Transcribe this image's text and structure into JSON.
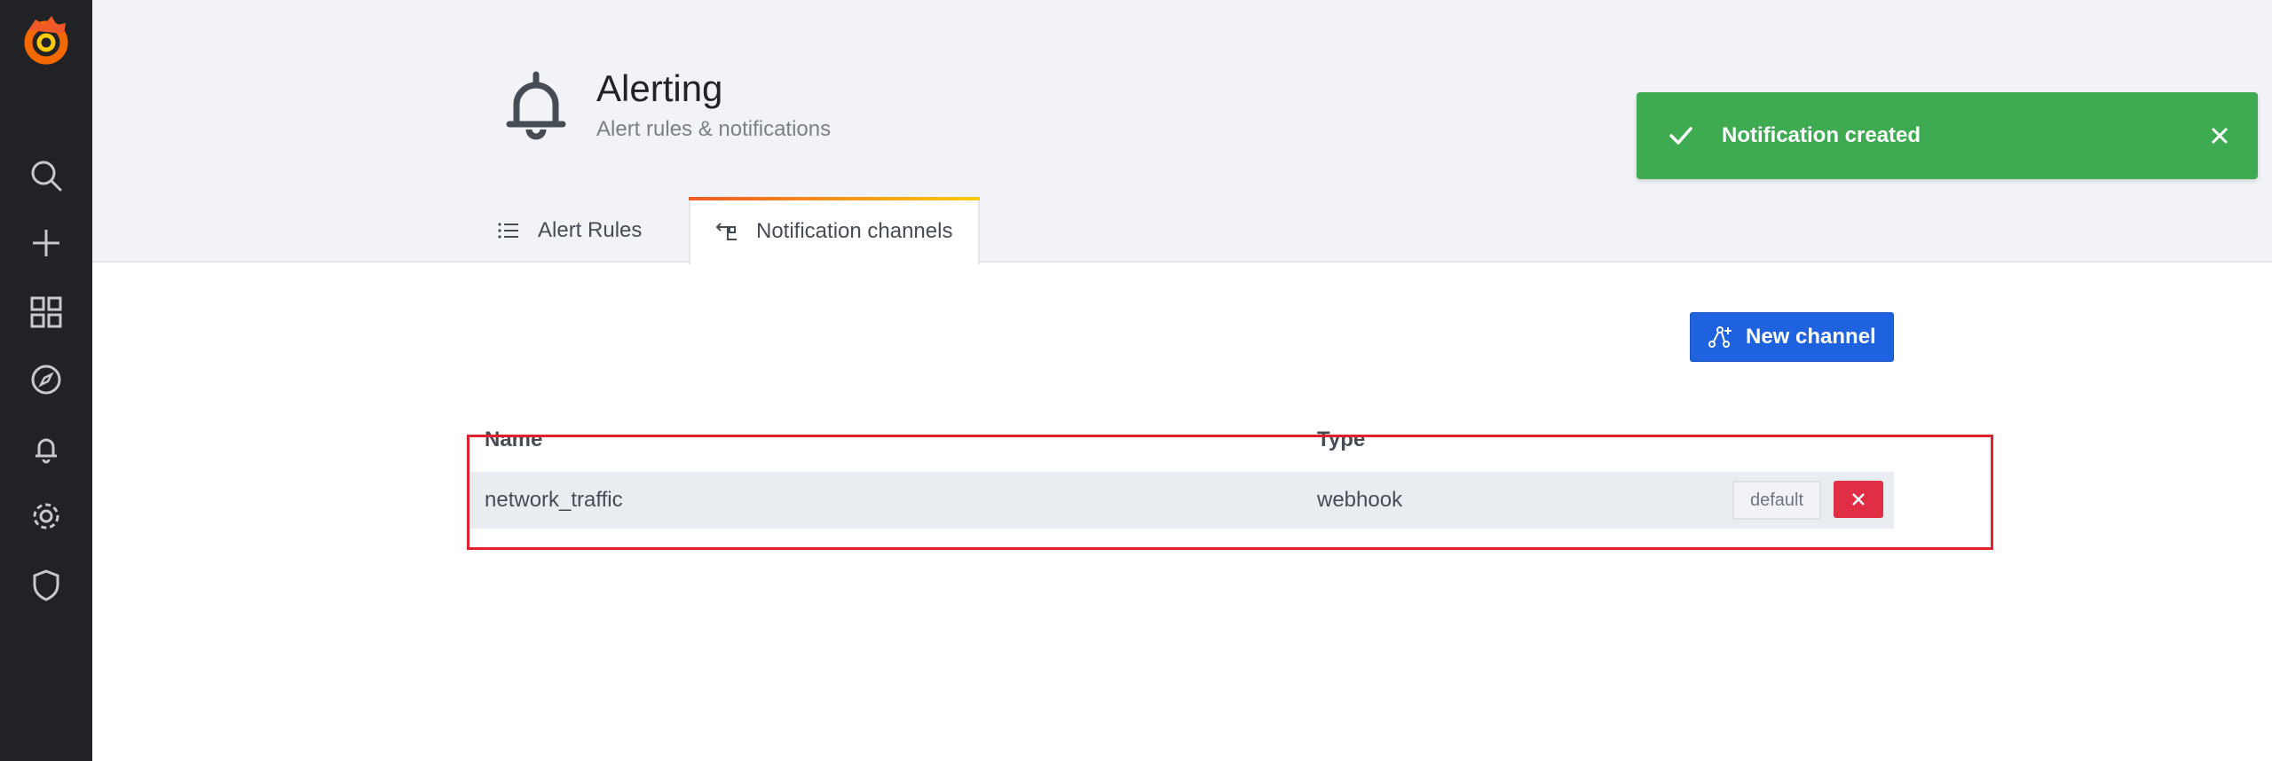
{
  "sidebar": {
    "icons": [
      "grafana-logo-icon",
      "search-icon",
      "plus-icon",
      "dashboards-icon",
      "explore-icon",
      "alerting-icon",
      "gear-icon",
      "shield-icon"
    ]
  },
  "header": {
    "title": "Alerting",
    "subtitle": "Alert rules & notifications",
    "tabs": [
      {
        "label": "Alert Rules",
        "active": false
      },
      {
        "label": "Notification channels",
        "active": true
      }
    ]
  },
  "toast": {
    "message": "Notification created",
    "color": "#3eab52"
  },
  "main": {
    "new_channel_label": "New channel",
    "columns": [
      "Name",
      "Type"
    ],
    "rows": [
      {
        "name": "network_traffic",
        "type": "webhook",
        "default_label": "default"
      }
    ]
  },
  "colors": {
    "sidebar": "#202226",
    "accent": "#1f62e0",
    "danger": "#e02f44"
  }
}
